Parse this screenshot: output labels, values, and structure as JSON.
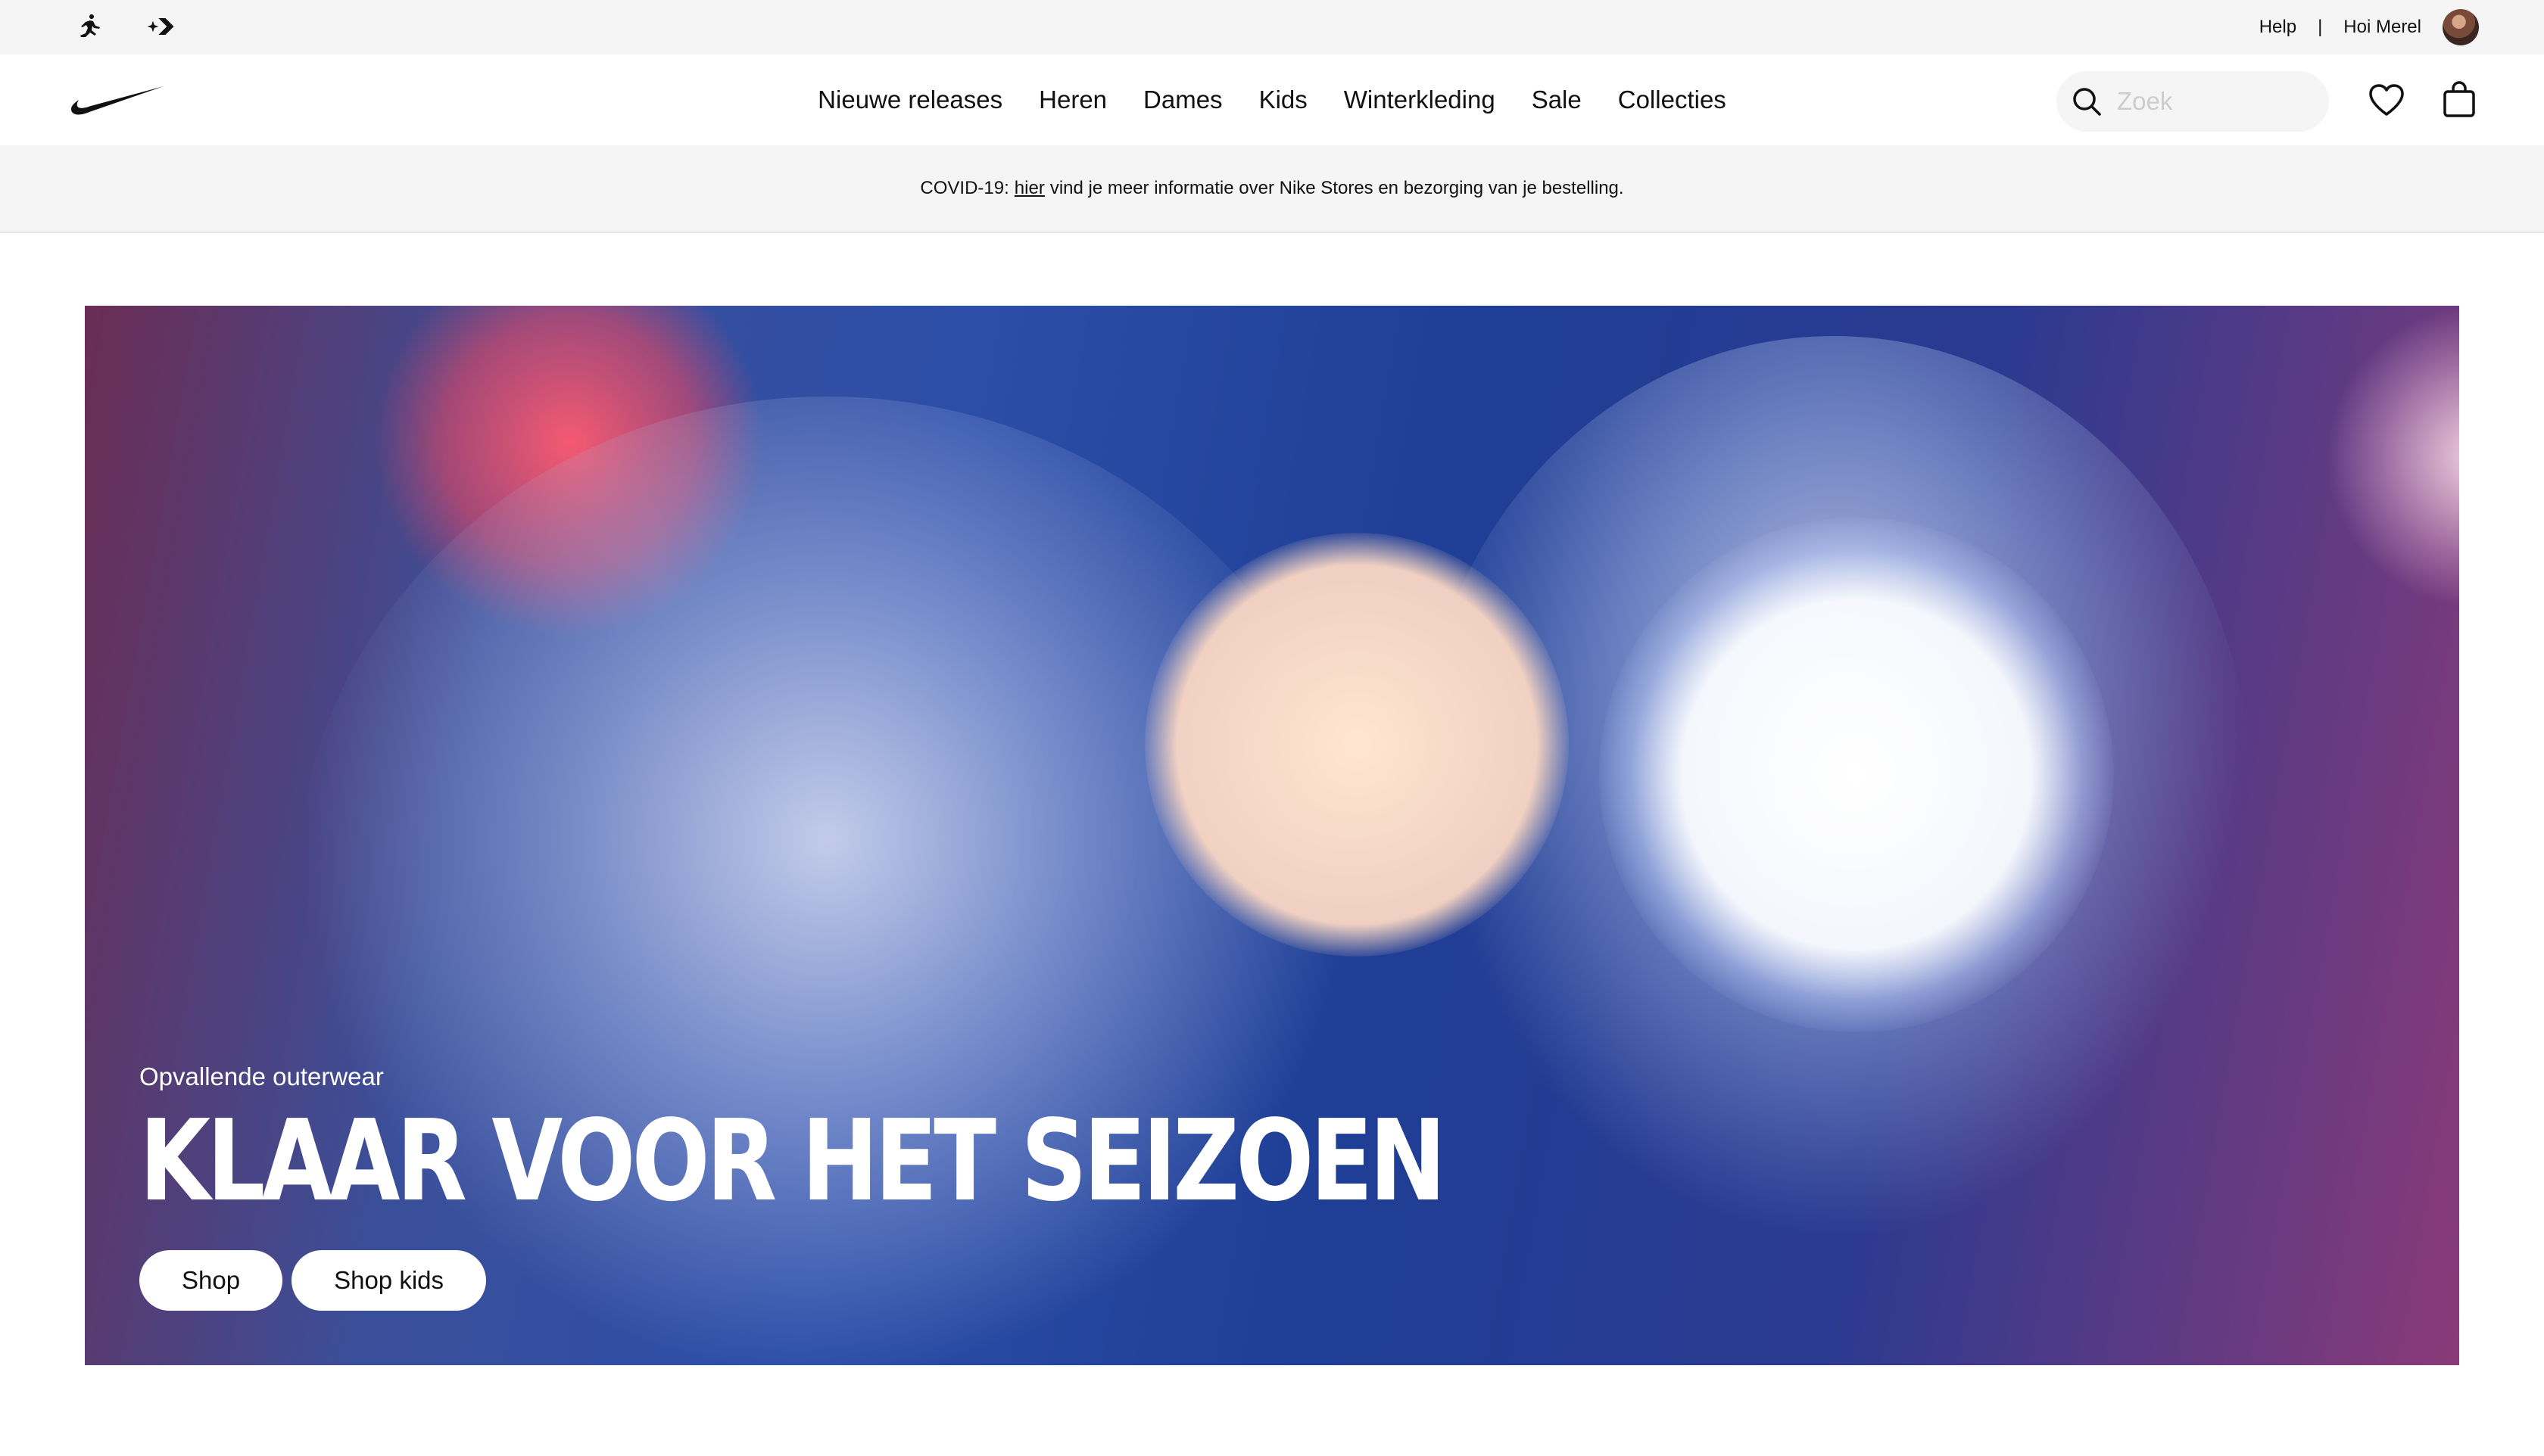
{
  "utility_bar": {
    "brand_icons": [
      "jordan-jumpman-icon",
      "converse-star-chevron-icon"
    ],
    "help_label": "Help",
    "separator": "|",
    "greeting": "Hoi Merel"
  },
  "header": {
    "logo": "nike-swoosh-icon",
    "nav": [
      {
        "label": "Nieuwe releases"
      },
      {
        "label": "Heren"
      },
      {
        "label": "Dames"
      },
      {
        "label": "Kids"
      },
      {
        "label": "Winterkleding"
      },
      {
        "label": "Sale"
      },
      {
        "label": "Collecties"
      }
    ],
    "search": {
      "placeholder": "Zoek",
      "value": ""
    },
    "icons": [
      "heart-icon",
      "shopping-bag-icon"
    ]
  },
  "covid_banner": {
    "prefix": "COVID-19:",
    "link": "hier",
    "suffix": "vind je meer informatie over Nike Stores en bezorging van je bestelling."
  },
  "hero": {
    "kicker": "Opvallende outerwear",
    "title": "KLAAR VOOR HET SEIZOEN",
    "buttons": [
      {
        "label": "Shop"
      },
      {
        "label": "Shop kids"
      }
    ]
  },
  "colors": {
    "utility_bg": "#f5f5f5",
    "text": "#111111",
    "hero_text": "#ffffff"
  }
}
